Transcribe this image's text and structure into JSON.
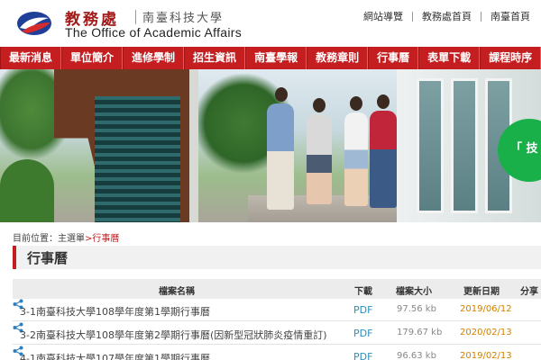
{
  "header": {
    "title_zh": "教務處",
    "university_zh": "南臺科技大學",
    "title_en": "The Office of Academic Affairs",
    "top_links": [
      "網站導覽",
      "教務處首頁",
      "南臺首頁"
    ]
  },
  "nav": {
    "items": [
      "最新消息",
      "單位簡介",
      "進修學制",
      "招生資訊",
      "南臺學報",
      "教務章則",
      "行事曆",
      "表單下載",
      "課程時序"
    ]
  },
  "banner": {
    "sign_text": "「 技"
  },
  "breadcrumb": {
    "prefix": "目前位置：",
    "home": "主選單",
    "separator": ">",
    "current": "行事曆"
  },
  "page": {
    "title": "行事曆"
  },
  "table": {
    "headers": {
      "name": "檔案名稱",
      "download": "下載",
      "size": "檔案大小",
      "date": "更新日期",
      "share": "分享"
    },
    "rows": [
      {
        "name": "3-1南臺科技大學108學年度第1學期行事曆",
        "download": "PDF",
        "size": "97.56 kb",
        "date": "2019/06/12"
      },
      {
        "name": "3-2南臺科技大學108學年度第2學期行事曆(因新型冠狀肺炎疫情重訂)",
        "download": "PDF",
        "size": "179.67 kb",
        "date": "2020/02/13"
      },
      {
        "name": "4-1南臺科技大學107學年度第1學期行事曆",
        "download": "PDF",
        "size": "96.63 kb",
        "date": "2019/02/13"
      }
    ]
  },
  "colors": {
    "brand_red": "#c41e21",
    "link_blue": "#2d8fbc",
    "date_orange": "#d08000"
  }
}
